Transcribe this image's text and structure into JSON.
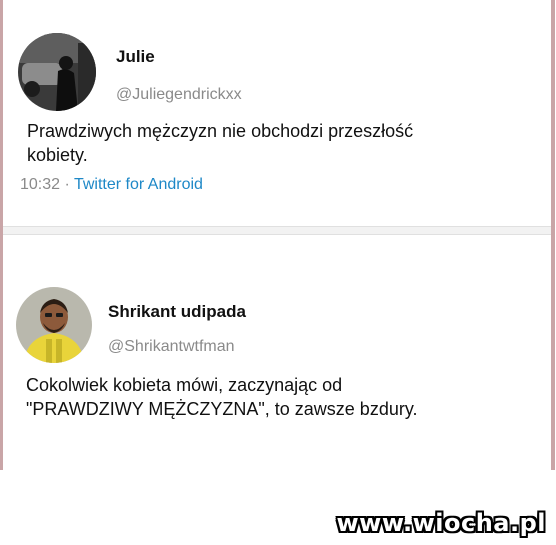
{
  "tweets": [
    {
      "name": "Julie",
      "handle": "@Juliegendrickxx",
      "text": "Prawdziwych mężczyzn nie obchodzi przeszłość\nkobiety.",
      "time": "10:32",
      "dot": "·",
      "source": "Twitter for Android"
    },
    {
      "name": "Shrikant udipada",
      "handle": "@Shrikantwtfman",
      "text": "Cokolwiek kobieta mówi, zaczynając od\n\"PRAWDZIWY MĘŻCZYZNA\", to zawsze bzdury."
    }
  ],
  "watermark": "www.wiocha.pl",
  "colors": {
    "border": "#c9a5a7",
    "link": "#1e88c7",
    "handle": "#8a8a8a"
  }
}
